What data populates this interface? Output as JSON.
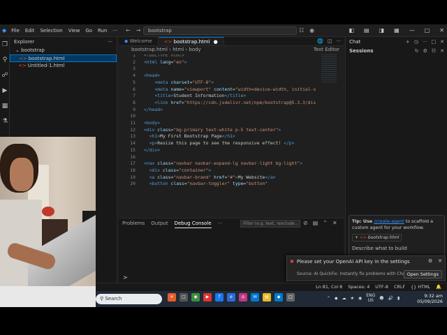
{
  "titlebar": {
    "menu": [
      "File",
      "Edit",
      "Selection",
      "View",
      "Go",
      "Run",
      "···"
    ],
    "search": "bootstrap"
  },
  "explorer": {
    "title": "Explorer",
    "folder": "bootstrap",
    "files": [
      "bootstrap.html",
      "Untitled-1.html"
    ]
  },
  "editor": {
    "tabs": [
      {
        "label": "Welcome",
        "active": false
      },
      {
        "label": "bootstrap.html",
        "active": true
      }
    ],
    "breadcrumb": [
      "bootstrap.html",
      "html",
      "body"
    ],
    "mode": "Text Editor",
    "lines": [
      {
        "n": "1",
        "html": "<span class='dt'>&lt;!DOCTYPE html&gt;</span>"
      },
      {
        "n": "2",
        "html": "<span class='tg'>&lt;html</span> <span class='at'>lang</span>=<span class='st'>\"en\"</span><span class='tg'>&gt;</span>"
      },
      {
        "n": "3",
        "html": ""
      },
      {
        "n": "4",
        "html": "<span class='tg'>&lt;head&gt;</span>"
      },
      {
        "n": "5",
        "html": "    <span class='tg'>&lt;meta</span> <span class='at'>charset</span>=<span class='st'>\"UTF-8\"</span><span class='tg'>&gt;</span>"
      },
      {
        "n": "6",
        "html": "    <span class='tg'>&lt;meta</span> <span class='at'>name</span>=<span class='st'>\"viewport\"</span> <span class='at'>content</span>=<span class='st'>\"width=device-width, initial-s</span>"
      },
      {
        "n": "7",
        "html": "    <span class='tg'>&lt;title&gt;</span>Student Information<span class='tg'>&lt;/title&gt;</span>"
      },
      {
        "n": "8",
        "html": "    <span class='tg'>&lt;link</span> <span class='at'>href</span>=<span class='st'>\"https://cdn.jsdelivr.net/npm/bootstrap@5.3.3/dis</span>"
      },
      {
        "n": "9",
        "html": "<span class='tg'>&lt;/head&gt;</span>"
      },
      {
        "n": "10",
        "html": ""
      },
      {
        "n": "11",
        "html": "<span class='tg'>&lt;body&gt;</span>"
      },
      {
        "n": "12",
        "html": "<span class='tg'>&lt;div</span> <span class='at'>class</span>=<span class='st'>\"bg-primary text-white p-5 text-center\"</span><span class='tg'>&gt;</span>"
      },
      {
        "n": "13",
        "html": "  <span class='tg'>&lt;h1&gt;</span>My First Bootstrap Page<span class='tg'>&lt;/h1&gt;</span>"
      },
      {
        "n": "14",
        "html": "  <span class='tg'>&lt;p&gt;</span>Resize this page to see the responsive effect! <span class='tg'>&lt;/p&gt;</span>"
      },
      {
        "n": "15",
        "html": "<span class='tg'>&lt;/div&gt;</span>"
      },
      {
        "n": "16",
        "html": ""
      },
      {
        "n": "17",
        "html": "<span class='tg'>&lt;nav</span> <span class='at'>class</span>=<span class='st'>\"navbar navbar-expand-lg navbar-light bg-light\"</span><span class='tg'>&gt;</span>"
      },
      {
        "n": "18",
        "html": "  <span class='tg'>&lt;div</span> <span class='at'>class</span>=<span class='st'>\"container\"</span><span class='tg'>&gt;</span>"
      },
      {
        "n": "19",
        "html": "  <span class='tg'>&lt;a</span> <span class='at'>class</span>=<span class='st'>\"navbar-brand\"</span> <span class='at'>href</span>=<span class='st'>\"#\"</span><span class='tg'>&gt;</span>My Website<span class='tg'>&lt;/a&gt;</span>"
      },
      {
        "n": "20",
        "html": "  <span class='tg'>&lt;button</span> <span class='at'>class</span>=<span class='st'>\"navbar-toggler\"</span> <span class='at'>type</span>=<span class='st'>\"button\"</span>"
      }
    ]
  },
  "panel": {
    "tabs": [
      "Problems",
      "Output",
      "Debug Console",
      "···"
    ],
    "active_tab": "Debug Console",
    "filter_placeholder": "Filter (e.g. text, !exclude...",
    "prompt": ">"
  },
  "chat": {
    "title": "Chat",
    "sessions": "Sessions",
    "tip_prefix": "Tip: Use ",
    "tip_link": "/create-agent",
    "tip_suffix": " to scaffold a custom agent for your workflow.",
    "context": "bootstrap.html",
    "placeholder": "Describe what to build"
  },
  "notification": {
    "message": "Please set your OpenAI API key in the settings",
    "source": "Source: AI QuickFix: Instantly fix problems with ChatGPT AI",
    "button": "Open Settings"
  },
  "statusbar": {
    "position": "Ln 81, Col 8",
    "spaces": "Spaces: 4",
    "encoding": "UTF-8",
    "eol": "CRLF",
    "language": "{} HTML"
  },
  "taskbar": {
    "search": "Search",
    "lang1": "ENG",
    "lang2": "US",
    "time": "9:32 am",
    "date": "05/09/2026"
  }
}
